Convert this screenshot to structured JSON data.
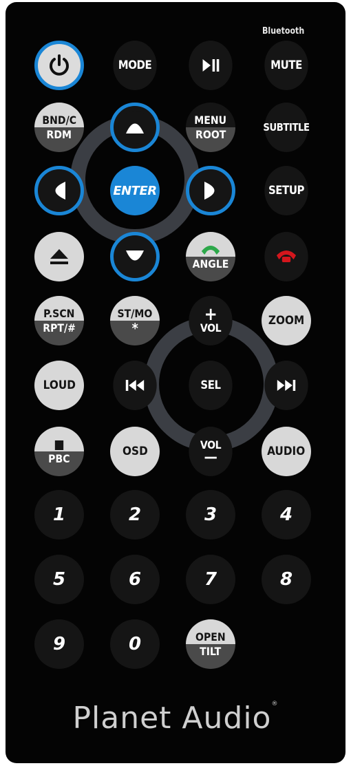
{
  "header": {
    "bluetooth_label": "Bluetooth"
  },
  "row1": {
    "mode": "MODE",
    "mute": "MUTE"
  },
  "row2": {
    "bnd_top": "BND/C",
    "bnd_bot": "RDM",
    "menu_top": "MENU",
    "menu_bot": "ROOT",
    "subtitle": "SUBTITLE"
  },
  "row3": {
    "enter": "ENTER",
    "setup": "SETUP"
  },
  "row4": {
    "angle": "ANGLE"
  },
  "row5": {
    "pscn_top": "P.SCN",
    "pscn_bot": "RPT/#",
    "stmo_top": "ST/MO",
    "stmo_bot": "*",
    "vol_up_sym": "+",
    "vol_up": "VOL",
    "zoom": "ZOOM"
  },
  "row6": {
    "loud": "LOUD",
    "sel": "SEL"
  },
  "row7": {
    "pbc": "PBC",
    "osd": "OSD",
    "vol_down": "VOL",
    "vol_down_sym": "—",
    "audio": "AUDIO"
  },
  "numbers": [
    "1",
    "2",
    "3",
    "4",
    "5",
    "6",
    "7",
    "8",
    "9",
    "0"
  ],
  "row10": {
    "open_top": "OPEN",
    "open_bot": "TILT"
  },
  "brand": {
    "name": "Planet Audio",
    "mark": "®"
  },
  "colors": {
    "accent_blue": "#1a86d6",
    "answer_green": "#2da84a",
    "hangup_red": "#d4161d",
    "ring_gray": "#3b3e44"
  }
}
